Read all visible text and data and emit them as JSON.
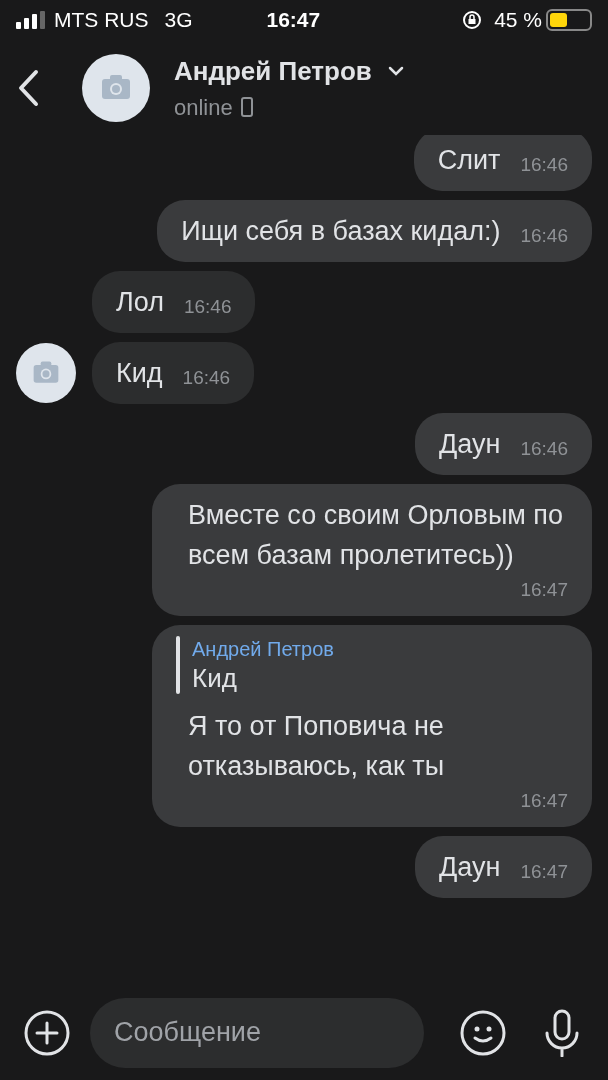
{
  "status_bar": {
    "carrier": "MTS RUS",
    "network": "3G",
    "time": "16:47",
    "battery_percent": "45 %"
  },
  "header": {
    "name": "Андрей Петров",
    "status": "online"
  },
  "messages": [
    {
      "kind": "outgoing",
      "text": "Слит",
      "time": "16:46"
    },
    {
      "kind": "outgoing",
      "text": "Ищи себя в базах кидал:)",
      "time": "16:46"
    },
    {
      "kind": "incoming",
      "text": "Лол",
      "time": "16:46",
      "avatar": false
    },
    {
      "kind": "incoming",
      "text": "Кид",
      "time": "16:46",
      "avatar": true
    },
    {
      "kind": "outgoing",
      "text": "Даун",
      "time": "16:46"
    },
    {
      "kind": "outgoing",
      "text": "Вместе со своим Орловым по всем базам пролетитесь))",
      "time": "16:47"
    },
    {
      "kind": "outgoing",
      "reply": {
        "author": "Андрей Петров",
        "text": "Кид"
      },
      "text": "Я то от Поповича не отказываюсь, как ты",
      "time": "16:47"
    },
    {
      "kind": "outgoing",
      "text": "Даун",
      "time": "16:47"
    }
  ],
  "composer": {
    "placeholder": "Сообщение"
  }
}
